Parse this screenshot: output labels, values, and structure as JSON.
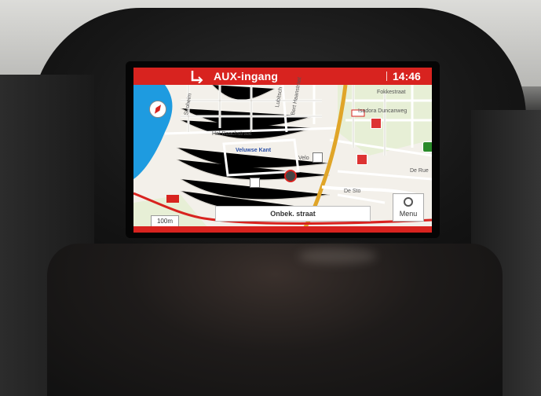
{
  "colors": {
    "header_bar": "#d8231f",
    "water": "#1e9be0",
    "map_bg": "#f1eee7",
    "main_road": "#e0a528",
    "route_red": "#d8231f"
  },
  "nav": {
    "title": "AUX-ingang",
    "clock": "14:46",
    "scale": "100m",
    "current_street": "Onbek. straat",
    "menu_label": "Menu"
  },
  "map_labels": {
    "hal_roachstraat": "Hal Roachstraat",
    "veluwse_kant": "Veluwse Kant",
    "isadora_duncanweg": "Isadora Duncanweg",
    "fokkestraat": "Fokkestraat",
    "de_rue": "De Rue",
    "de_sto": "De Sto",
    "velo": "Velo",
    "bert_haanstraat": "Bert Haanstraat",
    "lubitschst": "Lubitsch",
    "stroheim": "Stroheim"
  },
  "icons": {
    "back": "back-arrow-icon",
    "compass": "compass-icon",
    "menu": "menu-icon",
    "car": "car-position-icon"
  }
}
